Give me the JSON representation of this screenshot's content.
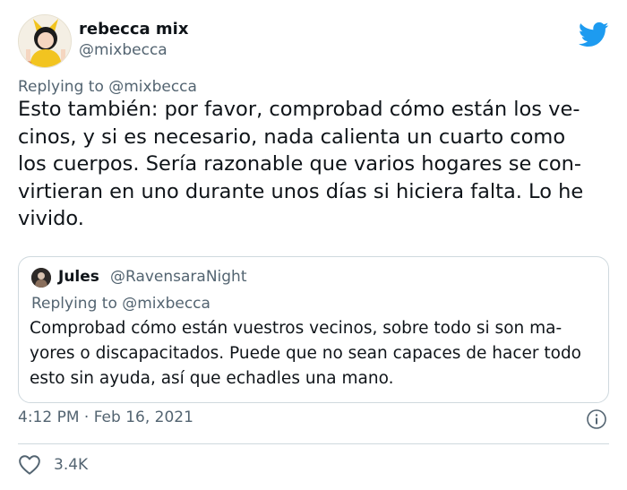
{
  "tweet": {
    "author": {
      "name": "rebecca mix",
      "handle": "@mixbecca"
    },
    "replying_to": "Replying to @mixbecca",
    "text": "Esto también: por favor, comprobad cómo están los ve-\ncinos, y si es necesario, nada calienta un cuarto como\nlos cuerpos. Sería razonable que varios hogares se con-\nvirtieran en uno durante unos días si hiciera falta. Lo he\nvivido.",
    "timestamp": "4:12 PM · Feb 16, 2021",
    "likes": "3.4K"
  },
  "quote": {
    "author": {
      "name": "Jules",
      "handle": "@RavensaraNight"
    },
    "replying_to": "Replying to @mixbecca",
    "text": "Comprobad cómo están vuestros vecinos, sobre todo si son ma-\nyores o discapacitados. Puede que no sean capaces de hacer todo\nesto sin ayuda, así que  echadles una mano."
  },
  "colors": {
    "twitter_blue": "#1d9bf0",
    "secondary_text": "#536471",
    "border": "#cfd9de"
  },
  "icons": [
    "twitter-bird-icon",
    "info-icon",
    "heart-icon"
  ]
}
